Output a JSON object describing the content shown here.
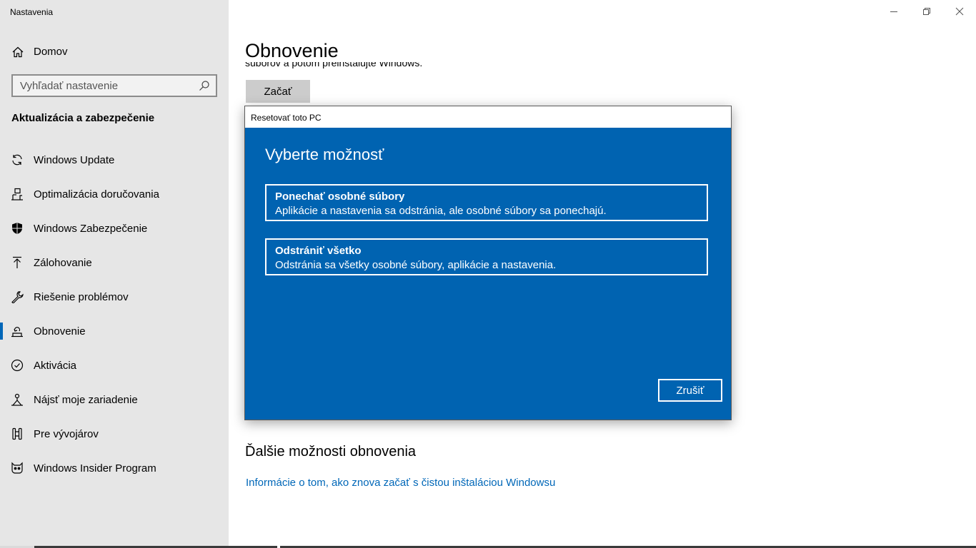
{
  "window": {
    "app_title": "Nastavenia"
  },
  "sidebar": {
    "home_label": "Domov",
    "search_placeholder": "Vyhľadať nastavenie",
    "section_title": "Aktualizácia a zabezpečenie",
    "items": [
      {
        "label": "Windows Update",
        "icon": "refresh-icon"
      },
      {
        "label": "Optimalizácia doručovania",
        "icon": "delivery-optimization-icon"
      },
      {
        "label": "Windows Zabezpečenie",
        "icon": "shield-icon"
      },
      {
        "label": "Zálohovanie",
        "icon": "backup-arrow-icon"
      },
      {
        "label": "Riešenie problémov",
        "icon": "wrench-icon"
      },
      {
        "label": "Obnovenie",
        "icon": "recovery-icon",
        "active": true
      },
      {
        "label": "Aktivácia",
        "icon": "check-circle-icon"
      },
      {
        "label": "Nájsť moje zariadenie",
        "icon": "person-pin-icon"
      },
      {
        "label": "Pre vývojárov",
        "icon": "developer-icon"
      },
      {
        "label": "Windows Insider Program",
        "icon": "insider-cat-icon"
      }
    ]
  },
  "main": {
    "page_title": "Obnovenie",
    "partial_text": "súborov a potom preinštalujte Windows.",
    "start_button": "Začať",
    "more_title": "Ďalšie možnosti obnovenia",
    "more_link": "Informácie o tom, ako znova začať s čistou inštaláciou Windowsu"
  },
  "dialog": {
    "title": "Resetovať toto PC",
    "heading": "Vyberte možnosť",
    "options": [
      {
        "title": "Ponechať osobné súbory",
        "description": "Aplikácie a nastavenia sa odstránia, ale osobné súbory sa ponechajú."
      },
      {
        "title": "Odstrániť všetko",
        "description": "Odstránia sa všetky osobné súbory, aplikácie a nastavenia."
      }
    ],
    "cancel_label": "Zrušiť"
  },
  "colors": {
    "accent": "#0067b8",
    "dialog_bg": "#0063b1",
    "sidebar_bg": "#e6e6e6"
  }
}
